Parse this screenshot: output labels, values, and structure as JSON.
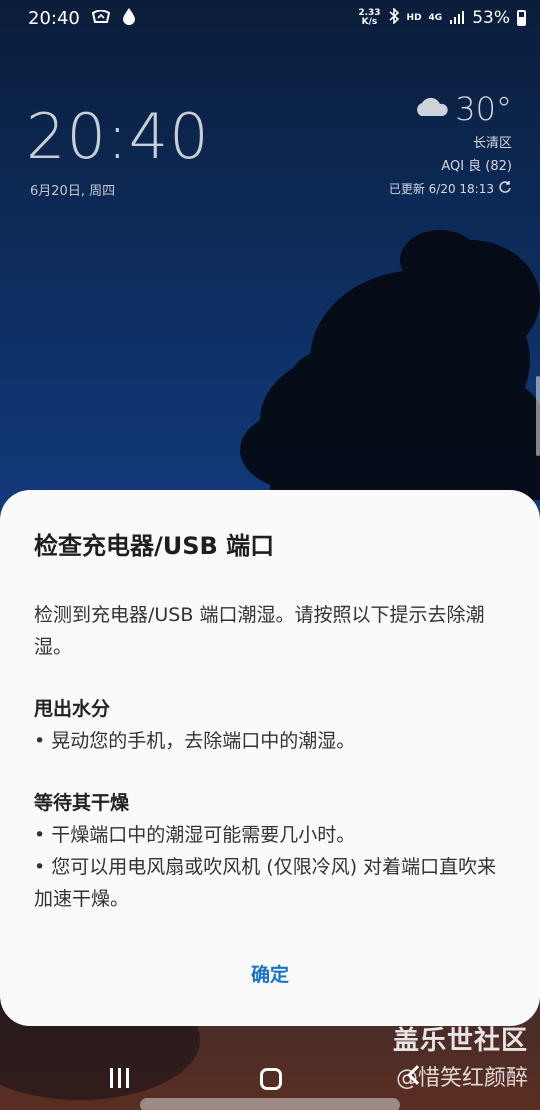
{
  "statusbar": {
    "time": "20:40",
    "net_speed_value": "2.33",
    "net_speed_unit": "K/s",
    "hd": "HD",
    "network": "4G",
    "battery": "53%"
  },
  "lockscreen": {
    "clock": "20:40",
    "date": "6月20日, 周四"
  },
  "weather": {
    "temp": "30°",
    "district": "长清区",
    "aqi": "AQI 良 (82)",
    "updated": "已更新 6/20 18:13"
  },
  "dialog": {
    "title": "检查充电器/USB 端口",
    "intro": "检测到充电器/USB 端口潮湿。请按照以下提示去除潮湿。",
    "section1_title": "甩出水分",
    "section1_item1": "• 晃动您的手机，去除端口中的潮湿。",
    "section2_title": "等待其干燥",
    "section2_item1": "• 干燥端口中的潮湿可能需要几小时。",
    "section2_item2": "• 您可以用电风扇或吹风机 (仅限冷风) 对着端口直吹来加速干燥。",
    "ok_label": "确定"
  },
  "watermark": {
    "site": "盖乐世社区",
    "user": "@惜笑红颜醉"
  },
  "colors": {
    "accent": "#1a73c8",
    "dialog_bg": "#fafafa"
  }
}
